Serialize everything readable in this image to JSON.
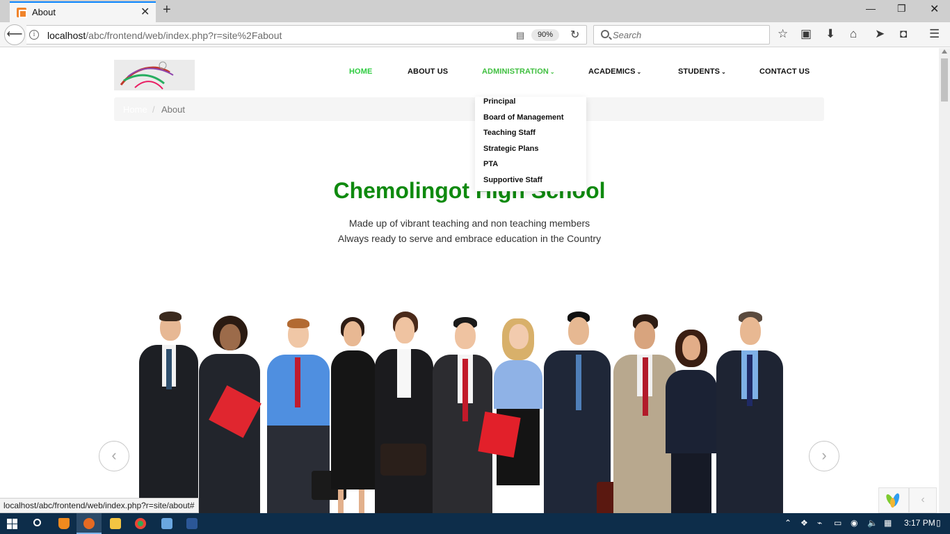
{
  "browser": {
    "tab_title": "About",
    "url_host": "localhost",
    "url_path": "/abc/frontend/web/index.php?r=site%2Fabout",
    "zoom": "90%",
    "search_placeholder": "Search",
    "status_url": "localhost/abc/frontend/web/index.php?r=site/about#"
  },
  "site": {
    "menu": {
      "home": "HOME",
      "about": "ABOUT US",
      "administration": "ADMINISTRATION",
      "academics": "ACADEMICS",
      "students": "STUDENTS",
      "contact": "CONTACT US"
    },
    "dropdown": [
      "Principal",
      "Board of Management",
      "Teaching Staff",
      "Strategic Plans",
      "PTA",
      "Supportive Staff"
    ],
    "breadcrumb": {
      "home": "Home",
      "separator": "/",
      "current": "About"
    },
    "title": "Chemolingot High School",
    "tagline_1": "Made up of vibrant teaching and non teaching members",
    "tagline_2": "Always ready to serve and embrace education in the Country",
    "colors": {
      "active_menu": "#2ecc40",
      "title": "#0f8a0f"
    }
  },
  "taskbar": {
    "clock": "3:17 PM"
  },
  "icons": [
    "back-arrow-icon",
    "info-icon",
    "reader-view-icon",
    "reload-icon",
    "search-icon",
    "bookmark-star-icon",
    "library-icon",
    "download-icon",
    "home-icon",
    "share-icon",
    "pocket-icon",
    "hamburger-menu-icon"
  ]
}
